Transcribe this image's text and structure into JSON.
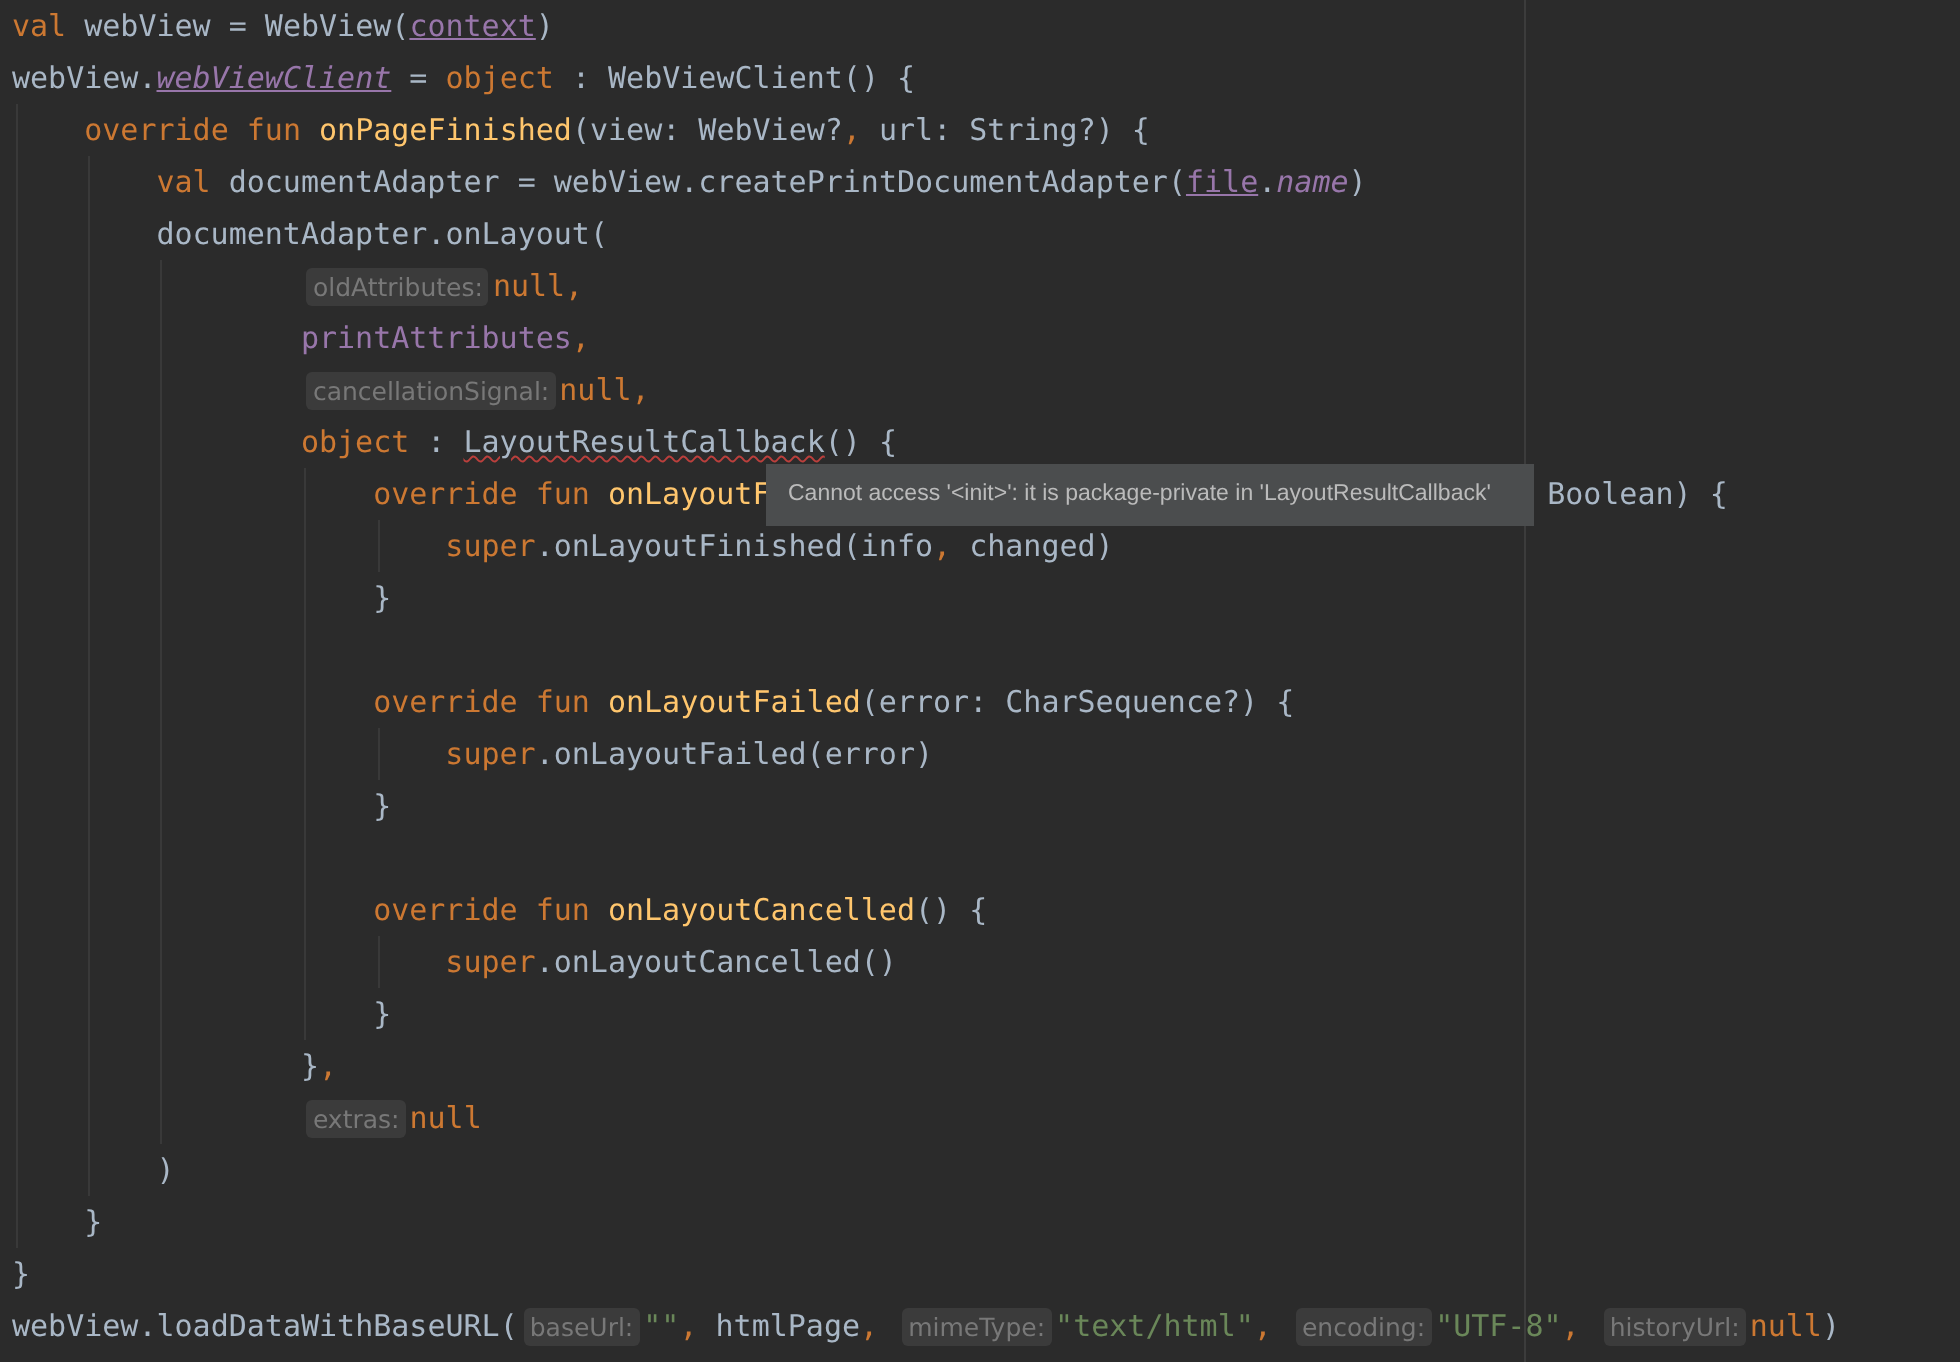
{
  "editor": {
    "lines": [
      {
        "tokens": [
          {
            "kind": "kw",
            "text": "val "
          },
          {
            "kind": "plain",
            "text": "webView = WebView("
          },
          {
            "kind": "var-link",
            "text": "context"
          },
          {
            "kind": "plain",
            "text": ")"
          }
        ]
      },
      {
        "tokens": [
          {
            "kind": "plain",
            "text": "webView."
          },
          {
            "kind": "var-link-italic",
            "text": "webViewClient"
          },
          {
            "kind": "plain",
            "text": " = "
          },
          {
            "kind": "kw",
            "text": "object"
          },
          {
            "kind": "plain",
            "text": " : WebViewClient() {"
          }
        ],
        "children": [
          {
            "tokens": [
              {
                "kind": "kw",
                "text": "override fun "
              },
              {
                "kind": "fn",
                "text": "onPageFinished"
              },
              {
                "kind": "plain",
                "text": "(view: WebView?"
              },
              {
                "kind": "kw",
                "text": ", "
              },
              {
                "kind": "plain",
                "text": "url: String?) {"
              }
            ],
            "children": [
              {
                "tokens": [
                  {
                    "kind": "kw",
                    "text": "val "
                  },
                  {
                    "kind": "plain",
                    "text": "documentAdapter = webView.createPrintDocumentAdapter("
                  },
                  {
                    "kind": "var-link",
                    "text": "file"
                  },
                  {
                    "kind": "plain",
                    "text": "."
                  },
                  {
                    "kind": "var-italic",
                    "text": "name"
                  },
                  {
                    "kind": "plain",
                    "text": ")"
                  }
                ]
              },
              {
                "kind": "call",
                "tokens": [
                  {
                    "kind": "plain",
                    "text": "documentAdapter.onLayout("
                  }
                ],
                "children": [
                  {
                    "tokens": [
                      {
                        "kind": "hint",
                        "text": "oldAttributes:"
                      },
                      {
                        "kind": "kw",
                        "text": "null,"
                      }
                    ]
                  },
                  {
                    "tokens": [
                      {
                        "kind": "var",
                        "text": "printAttributes"
                      },
                      {
                        "kind": "kw",
                        "text": ","
                      }
                    ]
                  },
                  {
                    "tokens": [
                      {
                        "kind": "hint",
                        "text": "cancellationSignal:"
                      },
                      {
                        "kind": "kw",
                        "text": "null,"
                      }
                    ]
                  },
                  {
                    "tokens": [
                      {
                        "kind": "kw",
                        "text": "object"
                      },
                      {
                        "kind": "plain",
                        "text": " : "
                      },
                      {
                        "kind": "type-error",
                        "text": "LayoutResultCallback"
                      },
                      {
                        "kind": "plain",
                        "text": "() {"
                      }
                    ],
                    "children": [
                      {
                        "tokens": [
                          {
                            "kind": "kw",
                            "text": "override fun "
                          },
                          {
                            "kind": "fn",
                            "text": "onLayoutF"
                          },
                          {
                            "kind": "covered"
                          },
                          {
                            "kind": "plain",
                            "text": "Boolean) {"
                          }
                        ],
                        "children": [
                          {
                            "tokens": [
                              {
                                "kind": "kw",
                                "text": "super"
                              },
                              {
                                "kind": "plain",
                                "text": ".onLayoutFinished(info"
                              },
                              {
                                "kind": "kw",
                                "text": ", "
                              },
                              {
                                "kind": "plain",
                                "text": "changed)"
                              }
                            ]
                          }
                        ]
                      },
                      {
                        "tokens": [
                          {
                            "kind": "plain",
                            "text": "}"
                          }
                        ]
                      },
                      {
                        "kind": "blank"
                      },
                      {
                        "tokens": [
                          {
                            "kind": "kw",
                            "text": "override fun "
                          },
                          {
                            "kind": "fn",
                            "text": "onLayoutFailed"
                          },
                          {
                            "kind": "plain",
                            "text": "(error: CharSequence?) {"
                          }
                        ],
                        "children": [
                          {
                            "tokens": [
                              {
                                "kind": "kw",
                                "text": "super"
                              },
                              {
                                "kind": "plain",
                                "text": ".onLayoutFailed(error)"
                              }
                            ]
                          }
                        ]
                      },
                      {
                        "tokens": [
                          {
                            "kind": "plain",
                            "text": "}"
                          }
                        ]
                      },
                      {
                        "kind": "blank"
                      },
                      {
                        "tokens": [
                          {
                            "kind": "kw",
                            "text": "override fun "
                          },
                          {
                            "kind": "fn",
                            "text": "onLayoutCancelled"
                          },
                          {
                            "kind": "plain",
                            "text": "() {"
                          }
                        ],
                        "children": [
                          {
                            "tokens": [
                              {
                                "kind": "kw",
                                "text": "super"
                              },
                              {
                                "kind": "plain",
                                "text": ".onLayoutCancelled()"
                              }
                            ]
                          }
                        ]
                      },
                      {
                        "tokens": [
                          {
                            "kind": "plain",
                            "text": "}"
                          }
                        ]
                      }
                    ]
                  },
                  {
                    "tokens": [
                      {
                        "kind": "plain",
                        "text": "}"
                      },
                      {
                        "kind": "kw",
                        "text": ","
                      }
                    ]
                  },
                  {
                    "tokens": [
                      {
                        "kind": "hint",
                        "text": "extras:"
                      },
                      {
                        "kind": "kw",
                        "text": "null"
                      }
                    ]
                  }
                ]
              },
              {
                "tokens": [
                  {
                    "kind": "plain",
                    "text": ")"
                  }
                ]
              }
            ]
          },
          {
            "tokens": [
              {
                "kind": "plain",
                "text": "}"
              }
            ]
          }
        ]
      },
      {
        "tokens": [
          {
            "kind": "plain",
            "text": "}"
          }
        ]
      },
      {
        "tokens": [
          {
            "kind": "plain",
            "text": "webView.loadDataWithBaseURL("
          },
          {
            "kind": "hint",
            "text": "baseUrl:"
          },
          {
            "kind": "str",
            "text": "\"\""
          },
          {
            "kind": "kw",
            "text": ", "
          },
          {
            "kind": "plain",
            "text": "htmlPage"
          },
          {
            "kind": "kw",
            "text": ", "
          },
          {
            "kind": "hint",
            "text": "mimeType:"
          },
          {
            "kind": "str",
            "text": "\"text/html\""
          },
          {
            "kind": "kw",
            "text": ", "
          },
          {
            "kind": "hint",
            "text": "encoding:"
          },
          {
            "kind": "str",
            "text": "\"UTF-8\""
          },
          {
            "kind": "kw",
            "text": ", "
          },
          {
            "kind": "hint",
            "text": "historyUrl:"
          },
          {
            "kind": "kw",
            "text": "null"
          },
          {
            "kind": "plain",
            "text": ")"
          }
        ]
      }
    ],
    "tooltip": {
      "text": "Cannot access '<init>': it is package-private in 'LayoutResultCallback'"
    }
  }
}
